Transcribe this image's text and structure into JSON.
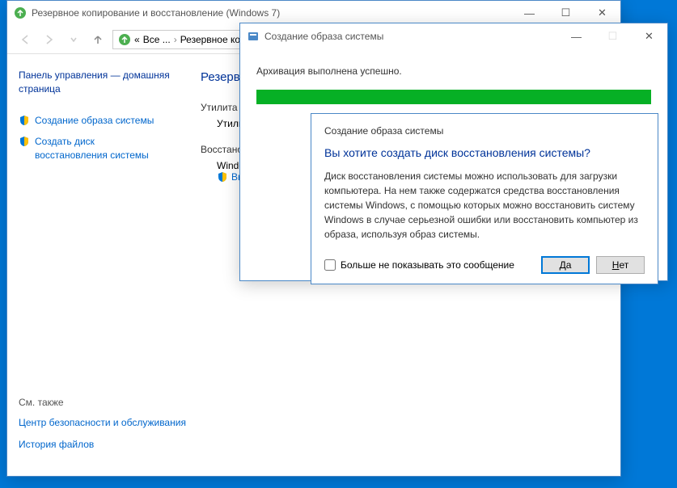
{
  "main": {
    "title": "Резервное копирование и восстановление (Windows 7)",
    "breadcrumb": {
      "all": "Все ...",
      "current": "Резервное коп..."
    },
    "sidebar": {
      "home": "Панель управления — домашняя страница",
      "links": [
        "Создание образа системы",
        "Создать диск восстановления системы"
      ],
      "seealso_hdr": "См. также",
      "seealso": [
        "Центр безопасности и обслуживания",
        "История файлов"
      ]
    },
    "content": {
      "heading": "Резервн",
      "util_hdr": "Утилита ар",
      "util_item": "Утилит",
      "restore_hdr": "Восстано",
      "restore_item": "Windo",
      "restore_link": "Выб"
    }
  },
  "progress": {
    "title": "Создание образа системы",
    "status": "Архивация выполнена успешно."
  },
  "dialog": {
    "caption": "Создание образа системы",
    "question": "Вы хотите создать диск восстановления системы?",
    "desc": "Диск восстановления системы можно использовать для загрузки компьютера. На нем также содержатся средства восстановления системы Windows, с помощью которых можно восстановить систему Windows в случае серьезной ошибки или восстановить компьютер из образа, используя образ системы.",
    "checkbox": "Больше не показывать это сообщение",
    "yes": "Да",
    "no": "Нет"
  }
}
